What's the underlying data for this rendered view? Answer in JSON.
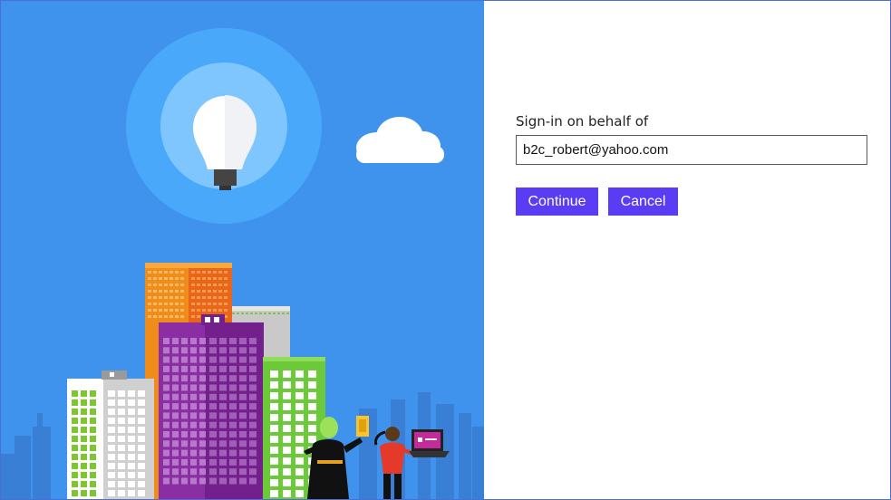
{
  "signin": {
    "label": "Sign-in on behalf of",
    "email_value": "b2c_robert@yahoo.com",
    "continue_label": "Continue",
    "cancel_label": "Cancel"
  },
  "hero": {
    "background_color": "#3f93ec",
    "icons": [
      "lightbulb-icon",
      "cloud-icon",
      "city-buildings",
      "people-illustration"
    ]
  },
  "colors": {
    "button": "#5b3cf5",
    "border": "#4a6fd8"
  }
}
